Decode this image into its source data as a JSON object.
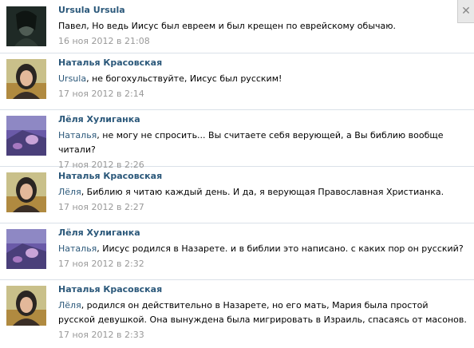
{
  "comments": [
    {
      "author": "Ursula Ursula",
      "reply_to": "",
      "text": "Павел, Но ведь Иисус был евреем и был крещен по еврейскому обычаю.",
      "date": "16 ноя 2012 в 21:08",
      "avatar": "dark-portrait"
    },
    {
      "author": "Наталья Красовская",
      "reply_to": "Ursula",
      "text": ", не богохульствуйте, Иисус был русским!",
      "date": "17 ноя 2012 в 2:14",
      "avatar": "woman-headscarf"
    },
    {
      "author": "Лёля Хулиганка",
      "reply_to": "Наталья",
      "text": ", не могу не спросить... Вы считаете себя верующей, а Вы библию вообще читали?",
      "date": "17 ноя 2012 в 2:26",
      "avatar": "purple-photo"
    },
    {
      "author": "Наталья Красовская",
      "reply_to": "Лёля",
      "text": ", Библию я читаю каждый день. И да, я верующая Православная Христианка.",
      "date": "17 ноя 2012 в 2:27",
      "avatar": "woman-headscarf"
    },
    {
      "author": "Лёля Хулиганка",
      "reply_to": "Наталья",
      "text": ", Иисус родился в Назарете. и в библии это написано. с каких пор он русский?",
      "date": "17 ноя 2012 в 2:32",
      "avatar": "purple-photo"
    },
    {
      "author": "Наталья Красовская",
      "reply_to": "Лёля",
      "text": ", родился он действительно в Назарете, но его мать, Мария была простой русской девушкой. Она вынуждена была мигрировать в Израиль, спасаясь от масонов.",
      "date": "17 ноя 2012 в 2:33",
      "avatar": "woman-headscarf"
    }
  ],
  "colors": {
    "link": "#2b587a",
    "date": "#999999",
    "divider": "#dae1e8"
  },
  "icons": {
    "corner": "close-icon"
  }
}
